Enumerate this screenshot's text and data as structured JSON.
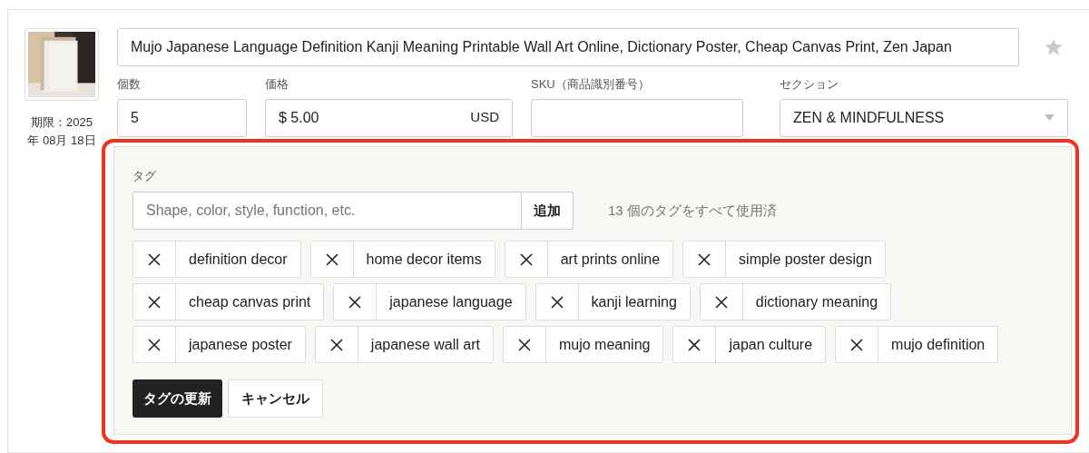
{
  "listing": {
    "title": "Mujo Japanese Language Definition Kanji Meaning Printable Wall Art Online, Dictionary Poster, Cheap Canvas Print, Zen Japan",
    "starred": false,
    "expiry": "期限：2025 年 08月 18日",
    "fields": [
      {
        "label": "個数",
        "value": "5"
      },
      {
        "label": "価格",
        "prefix": "$",
        "value": "5.00",
        "suffix": "USD"
      },
      {
        "label": "SKU（商品識別番号）"
      },
      {
        "label": "セクション",
        "value": "ZEN & MINDFULNESS"
      }
    ]
  },
  "tag_editor": {
    "label": "タグ",
    "placeholder": "Shape, color, style, function, etc.",
    "add_button": "追加",
    "count_note": "13 個のタグをすべて使用済",
    "tags": [
      "definition decor",
      "home decor items",
      "art prints online",
      "simple poster design",
      "cheap canvas print",
      "japanese language",
      "kanji learning",
      "dictionary meaning",
      "japanese poster",
      "japanese wall art",
      "mujo meaning",
      "japan culture",
      "mujo definition"
    ],
    "buttons": [
      {
        "label": "タグの更新",
        "kind": "primary"
      },
      {
        "label": "キャンセル",
        "kind": "secondary"
      }
    ]
  }
}
